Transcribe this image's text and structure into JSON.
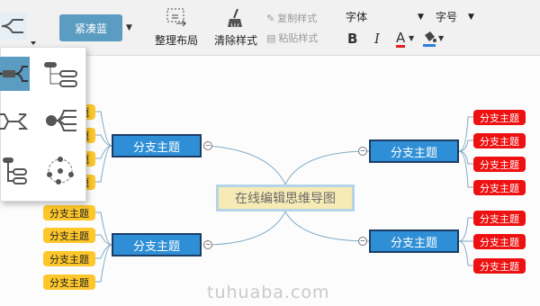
{
  "toolbar": {
    "theme_label": "紧凑蓝",
    "arrange_label": "整理布局",
    "clear_label": "清除样式",
    "copy_style_label": "复制样式",
    "paste_style_label": "粘贴样式",
    "font_label": "字体",
    "size_label": "字号",
    "bold": "B",
    "italic": "I",
    "font_color": "A"
  },
  "layout_menu": {
    "items": [
      "mind-map-layout",
      "tree-layout",
      "org-layout",
      "fishbone-layout",
      "list-layout",
      "free-layout"
    ]
  },
  "mindmap": {
    "center": "在线编辑思维导图",
    "branch_label": "分支主题",
    "leaf_label": "分支主题",
    "branches": [
      {
        "label": "分支主题"
      },
      {
        "label": "分支主题"
      },
      {
        "label": "分支主题"
      },
      {
        "label": "分支主题"
      }
    ],
    "left_top_leaves": [
      "分支主题",
      "分支主题",
      "分支主题",
      "分支主题"
    ],
    "left_bottom_leaves": [
      "分支主题",
      "分支主题",
      "分支主题",
      "分支主题"
    ],
    "right_top_leaves": [
      "分支主题",
      "分支主题",
      "分支主题",
      "分支主题"
    ],
    "right_bottom_leaves": [
      "分支主题",
      "分支主题",
      "分支主题"
    ]
  },
  "watermark": "tuhuaba.com",
  "colors": {
    "branch_fill": "#2f8fd6",
    "yellow_leaf": "#fdc72c",
    "red_leaf": "#ee1111",
    "center_fill": "#f7ebb5"
  }
}
